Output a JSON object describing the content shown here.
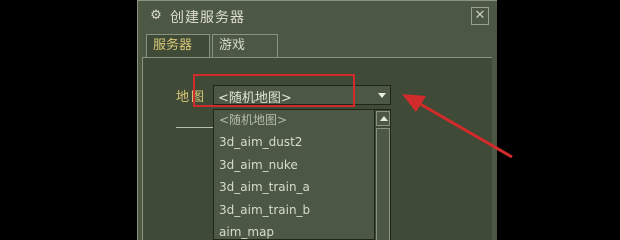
{
  "window": {
    "title": "创建服务器",
    "close_glyph": "✕",
    "title_icon": "steam-icon"
  },
  "tabs": [
    {
      "label": "服务器",
      "active": true
    },
    {
      "label": "游戏",
      "active": false
    }
  ],
  "map_field": {
    "label": "地图",
    "selected_value": "<随机地图>"
  },
  "dropdown": {
    "options": [
      "<随机地图>",
      "3d_aim_dust2",
      "3d_aim_nuke",
      "3d_aim_train_a",
      "3d_aim_train_b",
      "aim_map"
    ]
  },
  "annotation": {
    "highlight_color": "#d12b2b"
  },
  "colors": {
    "window_bg": "#4c5844",
    "panel_bg": "#3f4a37",
    "label_gold": "#d9c878",
    "text_light": "#d7dccc"
  }
}
